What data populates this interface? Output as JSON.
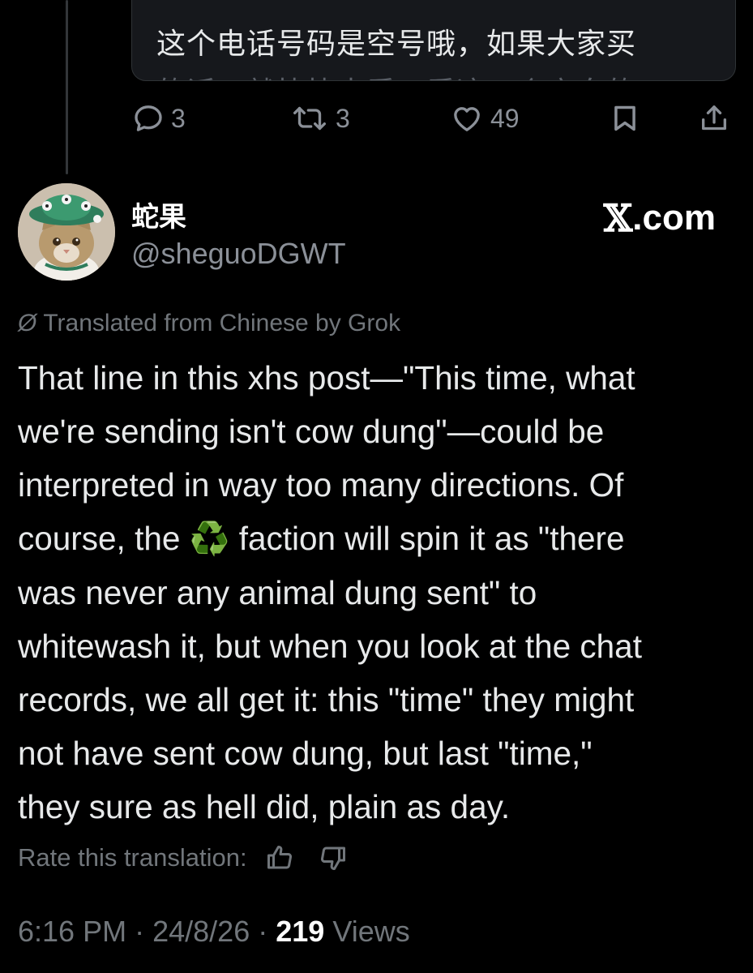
{
  "previous_post": {
    "text_line1": "这个电话号码是空号哦，如果大家买",
    "text_line2": "的话，就快快去看一看这一个方向的"
  },
  "actions": {
    "reply_count": "3",
    "repost_count": "3",
    "like_count": "49"
  },
  "author": {
    "display_name": "蛇果",
    "handle": "@sheguoDGWT"
  },
  "brand": {
    "x_mark": "𝕏",
    "suffix": ".com"
  },
  "translation": {
    "notice": "Translated from Chinese by Grok",
    "rate_label": "Rate this translation:"
  },
  "post": {
    "lines": [
      "That line in this xhs post—\"This time, what",
      "we're sending isn't cow dung\"—could be",
      "interpreted in way too many directions. Of",
      "course, the",
      "faction will spin it as \"there",
      "was never any animal dung sent\" to",
      "whitewash it, but when you look at the chat",
      "records, we all get it: this \"time\" they might",
      "not have sent cow dung, but last \"time,\"",
      "they sure as hell did, plain as day."
    ],
    "emoji": "♻️"
  },
  "meta": {
    "time": "6:16 PM",
    "separator": "·",
    "date": "24/8/26",
    "views_count": "219",
    "views_label": "Views"
  },
  "colors": {
    "background": "#000000",
    "text_primary": "#e7e9ea",
    "text_secondary": "#71767b",
    "recycle_green": "#23c449"
  },
  "icons": [
    "reply-icon",
    "repost-icon",
    "like-icon",
    "bookmark-icon",
    "share-icon",
    "translate-globe-icon",
    "thumbs-up-icon",
    "thumbs-down-icon"
  ]
}
